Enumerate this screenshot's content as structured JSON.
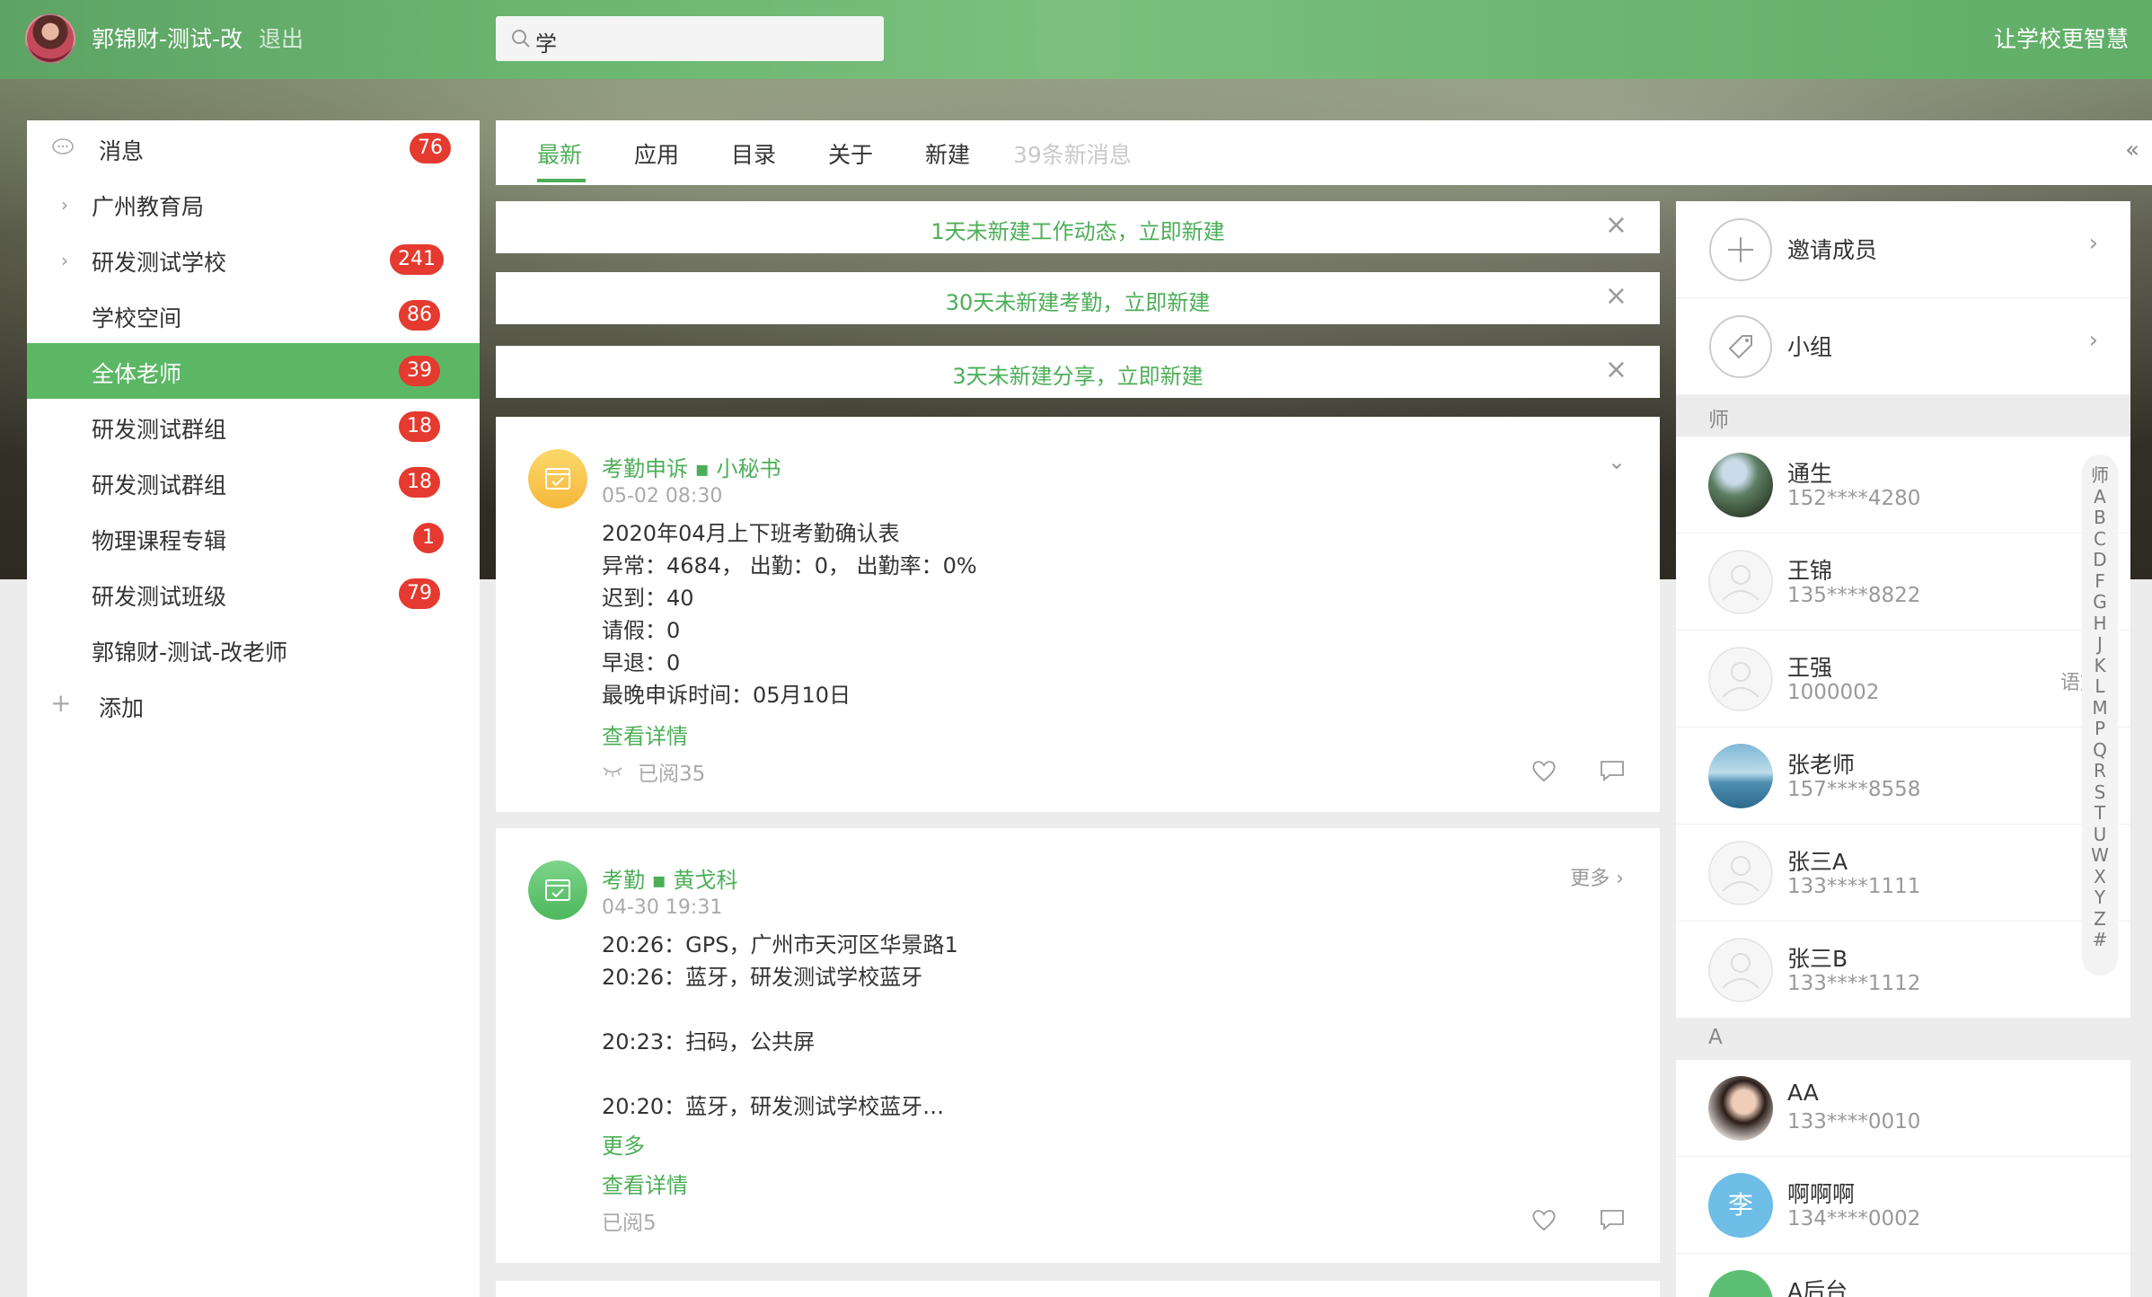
{
  "header": {
    "user_name": "郭锦财-测试-改",
    "logout": "退出",
    "search_value": "学",
    "slogan": "让学校更智慧"
  },
  "sidebar": {
    "items": [
      {
        "label": "消息",
        "badge": "76"
      },
      {
        "label": "广州教育局",
        "badge": ""
      },
      {
        "label": "研发测试学校",
        "badge": "241"
      },
      {
        "label": "学校空间",
        "badge": "86"
      },
      {
        "label": "全体老师",
        "badge": "39"
      },
      {
        "label": "研发测试群组",
        "badge": "18"
      },
      {
        "label": "研发测试群组",
        "badge": "18"
      },
      {
        "label": "物理课程专辑",
        "badge": "1"
      },
      {
        "label": "研发测试班级",
        "badge": "79"
      },
      {
        "label": "郭锦财-测试-改老师",
        "badge": ""
      },
      {
        "label": "添加",
        "badge": ""
      }
    ]
  },
  "tabs": {
    "latest": "最新",
    "apps": "应用",
    "catalog": "目录",
    "about": "关于",
    "create": "新建",
    "new_messages": "39条新消息"
  },
  "notices": [
    "1天未新建工作动态，立即新建",
    "30天未新建考勤，立即新建",
    "3天未新建分享，立即新建"
  ],
  "cards": [
    {
      "title": "考勤申诉 ▪ 小秘书",
      "time": "05-02 08:30",
      "lines": [
        "2020年04月上下班考勤确认表",
        "异常：4684， 出勤：0， 出勤率：0%",
        "迟到：40",
        "请假：0",
        "早退：0",
        "最晚申诉时间：05月10日"
      ],
      "detail_link": "查看详情",
      "read": "已阅35"
    },
    {
      "title": "考勤 ▪ 黄戈科",
      "time": "04-30 19:31",
      "more_label": "更多",
      "lines": [
        "20:26：GPS，广州市天河区华景路1",
        "20:26：蓝牙，研发测试学校蓝牙",
        "",
        "20:23：扫码，公共屏",
        "",
        "20:20：蓝牙，研发测试学校蓝牙…"
      ],
      "more_link": "更多",
      "detail_link": "查看详情",
      "read": "已阅5"
    }
  ],
  "right_panel": {
    "invite": "邀请成员",
    "group": "小组",
    "section_teacher": "师",
    "section_a": "A",
    "contacts": [
      {
        "name": "通生",
        "phone": "152****4280",
        "sub": ""
      },
      {
        "name": "王锦",
        "phone": "135****8822",
        "sub": ""
      },
      {
        "name": "王强",
        "phone": "1000002",
        "sub": "语文"
      },
      {
        "name": "张老师",
        "phone": "157****8558",
        "sub": ""
      },
      {
        "name": "张三A",
        "phone": "133****1111",
        "sub": ""
      },
      {
        "name": "张三B",
        "phone": "133****1112",
        "sub": ""
      },
      {
        "name": "AA",
        "phone": "133****0010",
        "sub": ""
      },
      {
        "name": "啊啊啊",
        "phone": "134****0002",
        "sub": "",
        "avatar_text": "李"
      },
      {
        "name": "A后台",
        "phone": "",
        "sub": ""
      }
    ],
    "alphabet": [
      "师",
      "A",
      "B",
      "C",
      "D",
      "F",
      "G",
      "H",
      "J",
      "K",
      "L",
      "M",
      "P",
      "Q",
      "R",
      "S",
      "T",
      "U",
      "W",
      "X",
      "Y",
      "Z",
      "#"
    ]
  },
  "colors": {
    "accent": "#4cae57",
    "active_bg": "#5cb765",
    "badge": "#e53a2f"
  }
}
